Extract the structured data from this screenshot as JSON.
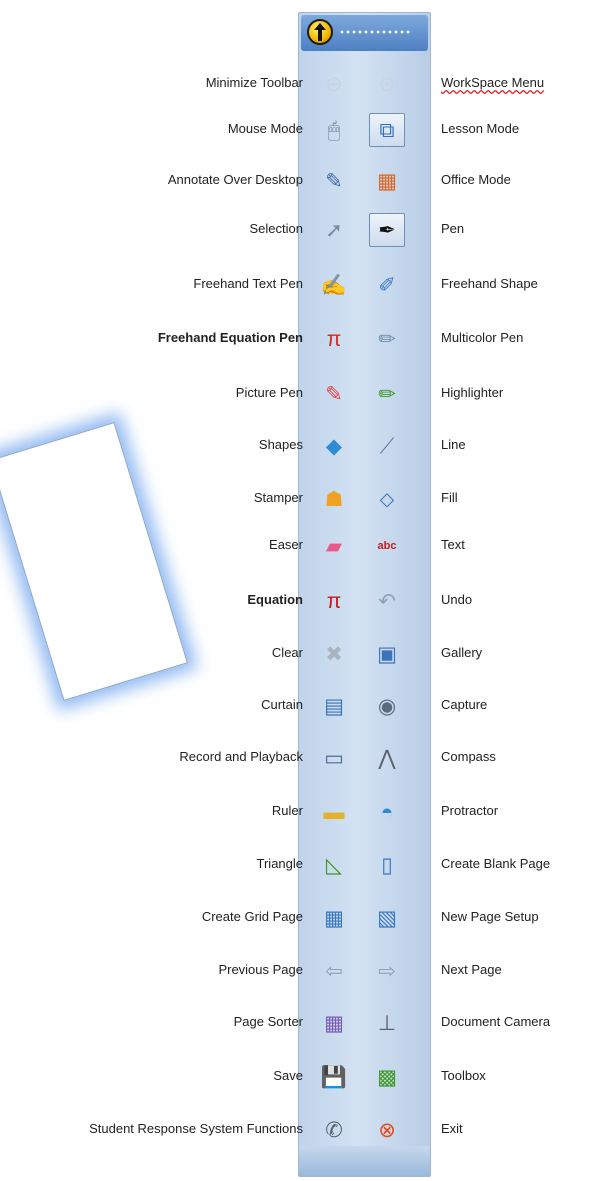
{
  "toolbar": {
    "rows": [
      {
        "left": "Minimize Toolbar",
        "right": "WorkSpace Menu",
        "l_icon": "minimize-icon",
        "r_icon": "workspace-menu-icon",
        "lg": "⊖",
        "rg": "⊙",
        "lc": "#c9d3de",
        "rc": "#c9d3de"
      },
      {
        "left": "Mouse Mode",
        "right": "Lesson Mode",
        "l_icon": "mouse-icon",
        "r_icon": "lesson-mode-icon",
        "lg": "🖱",
        "rg": "⧉",
        "lc": "#6b7c90",
        "rc": "#2f6fc4"
      },
      {
        "left": "Annotate Over Desktop",
        "right": "Office Mode",
        "l_icon": "annotate-desktop-icon",
        "r_icon": "office-mode-icon",
        "lg": "✎",
        "rg": "▦",
        "lc": "#3d6aa5",
        "rc": "#e0641e"
      },
      {
        "left": "Selection",
        "right": "Pen",
        "l_icon": "selection-arrow-icon",
        "r_icon": "pen-icon",
        "lg": "➚",
        "rg": "✒",
        "lc": "#7c8da3",
        "rc": "#111111"
      },
      {
        "left": "Freehand Text Pen",
        "right": "Freehand Shape",
        "l_icon": "freehand-text-pen-icon",
        "r_icon": "freehand-shape-icon",
        "lg": "✍",
        "rg": "✐",
        "lc": "#3a7cc4",
        "rc": "#3a7cc4"
      },
      {
        "left": "Freehand Equation Pen",
        "right": "Multicolor Pen",
        "l_icon": "equation-pen-icon",
        "r_icon": "multicolor-pen-icon",
        "lg": "π",
        "rg": "✏",
        "lc": "#d62a1f",
        "rc": "#6f8fa6"
      },
      {
        "left": "Picture Pen",
        "right": "Highlighter",
        "l_icon": "picture-pen-icon",
        "r_icon": "highlighter-icon",
        "lg": "✎",
        "rg": "✏",
        "lc": "#e24747",
        "rc": "#3d9a24"
      },
      {
        "left": "Shapes",
        "right": "Line",
        "l_icon": "shapes-icon",
        "r_icon": "line-icon",
        "lg": "◆",
        "rg": "⟋",
        "lc": "#2f8bd6",
        "rc": "#5d7fa8"
      },
      {
        "left": "Stamper",
        "right": "Fill",
        "l_icon": "stamper-icon",
        "r_icon": "fill-bucket-icon",
        "lg": "☗",
        "rg": "⬦",
        "lc": "#f0a224",
        "rc": "#3a78c2"
      },
      {
        "left": "Easer",
        "right": "Text",
        "l_icon": "eraser-icon",
        "r_icon": "text-icon",
        "lg": "▰",
        "rg": "abc",
        "lc": "#e75a8a",
        "rc": "#c21d1d"
      },
      {
        "left": "Equation",
        "right": "Undo",
        "l_icon": "equation-icon",
        "r_icon": "undo-icon",
        "lg": "π",
        "rg": "↶",
        "lc": "#c21d1d",
        "rc": "#8fa2b6"
      },
      {
        "left": "Clear",
        "right": "Gallery",
        "l_icon": "clear-icon",
        "r_icon": "gallery-icon",
        "lg": "✖",
        "rg": "▣",
        "lc": "#aab4bf",
        "rc": "#3d73b8"
      },
      {
        "left": "Curtain",
        "right": "Capture",
        "l_icon": "curtain-icon",
        "r_icon": "capture-camera-icon",
        "lg": "▤",
        "rg": "◉",
        "lc": "#3b73b7",
        "rc": "#5a6b7c"
      },
      {
        "left": "Record and Playback",
        "right": "Compass",
        "l_icon": "record-playback-icon",
        "r_icon": "compass-icon",
        "lg": "▭",
        "rg": "⋀",
        "lc": "#4e6f95",
        "rc": "#59626d"
      },
      {
        "left": "Ruler",
        "right": "Protractor",
        "l_icon": "ruler-icon",
        "r_icon": "protractor-icon",
        "lg": "▬",
        "rg": "◓",
        "lc": "#e4b12b",
        "rc": "#2f8bd6"
      },
      {
        "left": "Triangle",
        "right": "Create Blank Page",
        "l_icon": "triangle-icon",
        "r_icon": "blank-page-icon",
        "lg": "◺",
        "rg": "▯",
        "lc": "#3d9a24",
        "rc": "#3a78c2"
      },
      {
        "left": "Create Grid Page",
        "right": "New Page Setup",
        "l_icon": "grid-page-icon",
        "r_icon": "page-setup-icon",
        "lg": "▦",
        "rg": "▧",
        "lc": "#3a78c2",
        "rc": "#3a78c2"
      },
      {
        "left": "Previous Page",
        "right": "Next Page",
        "l_icon": "arrow-left-icon",
        "r_icon": "arrow-right-icon",
        "lg": "⇦",
        "rg": "⇨",
        "lc": "#8fa2b6",
        "rc": "#8fa2b6"
      },
      {
        "left": "Page Sorter",
        "right": "Document Camera",
        "l_icon": "page-sorter-icon",
        "r_icon": "document-camera-icon",
        "lg": "▦",
        "rg": "⊥",
        "lc": "#7a5bb8",
        "rc": "#59626d"
      },
      {
        "left": "Save",
        "right": "Toolbox",
        "l_icon": "save-disk-icon",
        "r_icon": "toolbox-icon",
        "lg": "💾",
        "rg": "▩",
        "lc": "#59626d",
        "rc": "#3d9a24"
      },
      {
        "left": "Student Response System Functions",
        "right": "Exit",
        "l_icon": "response-system-icon",
        "r_icon": "exit-icon",
        "lg": "✆",
        "rg": "⊗",
        "lc": "#59626d",
        "rc": "#e24a1f"
      }
    ]
  }
}
